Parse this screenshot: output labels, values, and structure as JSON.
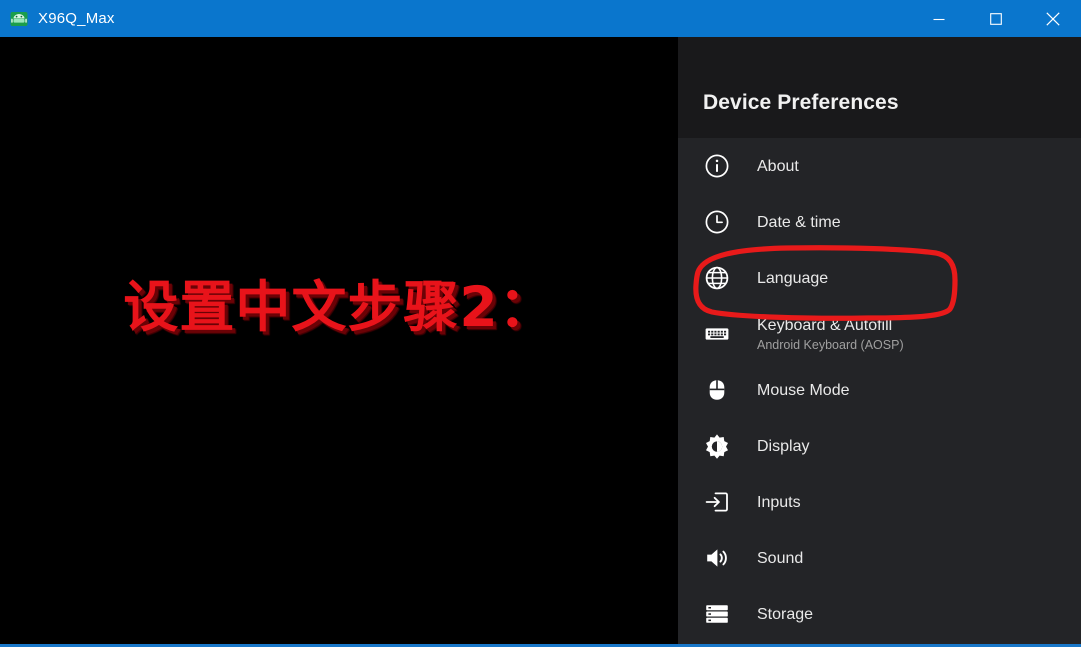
{
  "window": {
    "title": "X96Q_Max",
    "icon": "android-robot-icon",
    "titlebar_color": "#0a76cd",
    "controls": {
      "minimize_label": "Minimize",
      "maximize_label": "Maximize",
      "close_label": "Close"
    }
  },
  "overlay": {
    "text": "设置中文步骤2：",
    "color": "#e8131a",
    "shadow_color": "#6b0206"
  },
  "panel": {
    "title": "Device Preferences",
    "header_bg": "#19191b",
    "body_bg": "#232427",
    "items": [
      {
        "label": "About",
        "sub": "",
        "icon": "info-circle-icon"
      },
      {
        "label": "Date & time",
        "sub": "",
        "icon": "clock-icon"
      },
      {
        "label": "Language",
        "sub": "",
        "icon": "globe-icon"
      },
      {
        "label": "Keyboard & Autofill",
        "sub": "Android Keyboard (AOSP)",
        "icon": "keyboard-icon"
      },
      {
        "label": "Mouse Mode",
        "sub": "",
        "icon": "mouse-icon"
      },
      {
        "label": "Display",
        "sub": "",
        "icon": "brightness-icon"
      },
      {
        "label": "Inputs",
        "sub": "",
        "icon": "input-arrow-icon"
      },
      {
        "label": "Sound",
        "sub": "",
        "icon": "speaker-icon"
      },
      {
        "label": "Storage",
        "sub": "",
        "icon": "storage-icon"
      }
    ]
  },
  "annotation": {
    "target": "Language",
    "shape": "hand-drawn-rounded-rectangle",
    "color": "#e81a1a"
  }
}
